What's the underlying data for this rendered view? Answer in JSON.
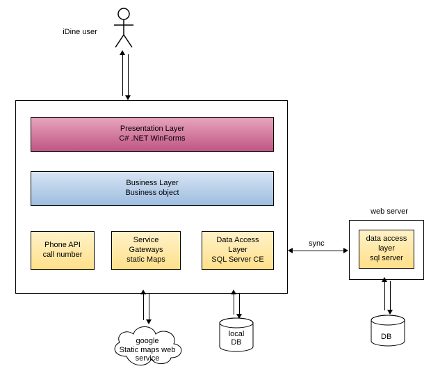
{
  "user_label": "iDine user",
  "presentation": {
    "line1": "Presentation Layer",
    "line2": "C# .NET WinForms"
  },
  "business": {
    "line1": "Business Layer",
    "line2": "Business object"
  },
  "phone_api": {
    "line1": "Phone API",
    "line2": "call number"
  },
  "service_gw": {
    "line1": "Service",
    "line2": "Gateways",
    "line3": "static Maps"
  },
  "data_access": {
    "line1": "Data Access",
    "line2": "Layer",
    "line3": "SQL Server CE"
  },
  "sync_label": "sync",
  "web_server_label": "web server",
  "web_data_access": {
    "line1": "data access",
    "line2": "layer",
    "line3": "sql server"
  },
  "cloud": {
    "line1": "google",
    "line2": "Static maps web",
    "line3": "service"
  },
  "local_db_label1": "local",
  "local_db_label2": "DB",
  "remote_db_label": "DB"
}
